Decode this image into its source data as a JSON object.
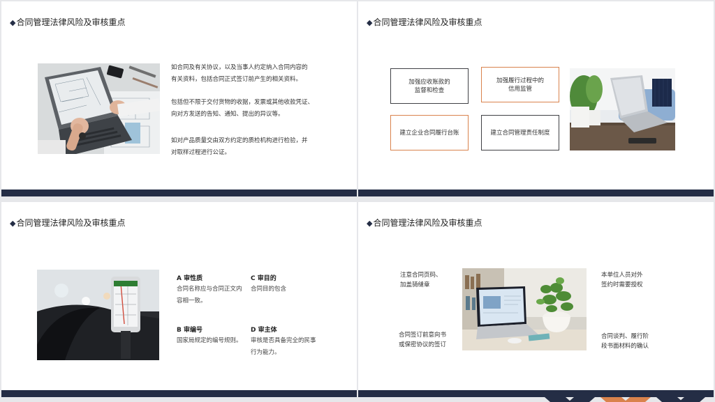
{
  "slides": [
    {
      "title": "合同管理法律风险及审核重点",
      "paragraphs": [
        "如合同及有关协议，以及当事人约定纳入合同内容的",
        "有关资料，包括合同正式签订前产生的相关资料。",
        "包括但不限于交付货物的收据，发票或其他收款凭证、",
        "向对方发送的告知、通知、提出的异议等。",
        "如对产品质量交由双方约定的质检机构进行检验，并",
        "对取样过程进行公证。"
      ],
      "image": "laptop-blueprint-photo"
    },
    {
      "title": "合同管理法律风险及审核重点",
      "boxes": [
        {
          "line1": "加强应收账款的",
          "line2": "监督和检查"
        },
        {
          "line1": "加强履行过程中的",
          "line2": "信用监管"
        },
        {
          "line1": "建立企业合同履行台账",
          "line2": ""
        },
        {
          "line1": "建立合同管理责任制度",
          "line2": ""
        }
      ],
      "image": "laptop-plant-sofa-photo"
    },
    {
      "title": "合同管理法律风险及审核重点",
      "items": [
        {
          "head": "A  审性质",
          "desc": "合同名称应与合同正文内容相一致。"
        },
        {
          "head": "C  审目的",
          "desc": "合同目的包含"
        },
        {
          "head": "B  审编号",
          "desc": "国家局规定的编号规则。"
        },
        {
          "head": "D  审主体",
          "desc": "审核是否具备完全的民事行为能力。"
        }
      ],
      "image": "car-phone-navigation-photo"
    },
    {
      "title": "合同管理法律风险及审核重点",
      "notes": [
        {
          "line1": "注意合同页码、",
          "line2": "加盖骑缝章"
        },
        {
          "line1": "本单位人员对外",
          "line2": "签约时需要授权"
        },
        {
          "line1": "合同签订前意向书",
          "line2": "或保密协议的签订"
        },
        {
          "line1": "合同谈判、履行阶",
          "line2": "段书面材料的确认"
        }
      ],
      "image": "desk-laptop-plant-photo"
    }
  ],
  "colors": {
    "navy": "#242d45",
    "orange": "#d9824c",
    "dark_border": "#3f4044"
  }
}
